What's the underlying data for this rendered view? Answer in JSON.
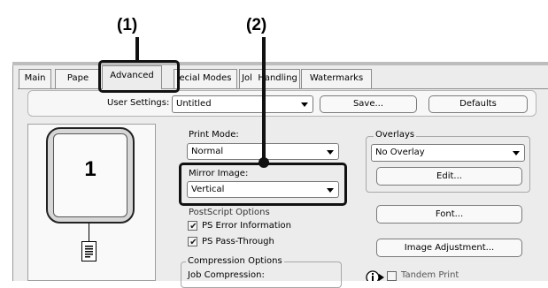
{
  "callouts": {
    "c1": "(1)",
    "c2": "(2)"
  },
  "tabs": [
    "Main",
    "Paper",
    "Advanced",
    "Special Modes",
    "Job Handling",
    "Watermarks"
  ],
  "tab_display": [
    "Main",
    "Pape",
    "Advanced",
    "ecial Modes",
    "Jol",
    "Handling",
    "Watermarks"
  ],
  "user_settings": {
    "label": "User Settings:",
    "value": "Untitled",
    "save_label": "Save...",
    "defaults_label": "Defaults"
  },
  "preview": {
    "page_number": "1"
  },
  "print_mode": {
    "label": "Print Mode:",
    "value": "Normal"
  },
  "mirror_image": {
    "label": "Mirror Image:",
    "value": "Vertical"
  },
  "postscript": {
    "label": "PostScript Options",
    "ps_error": "PS Error Information",
    "ps_pass": "PS Pass-Through"
  },
  "compression": {
    "label": "Compression Options",
    "job_compression": "Job Compression:"
  },
  "overlays": {
    "label": "Overlays",
    "value": "No Overlay",
    "edit_label": "Edit..."
  },
  "buttons": {
    "font": "Font...",
    "image_adjustment": "Image Adjustment..."
  },
  "tandem": {
    "label": "Tandem Print"
  }
}
